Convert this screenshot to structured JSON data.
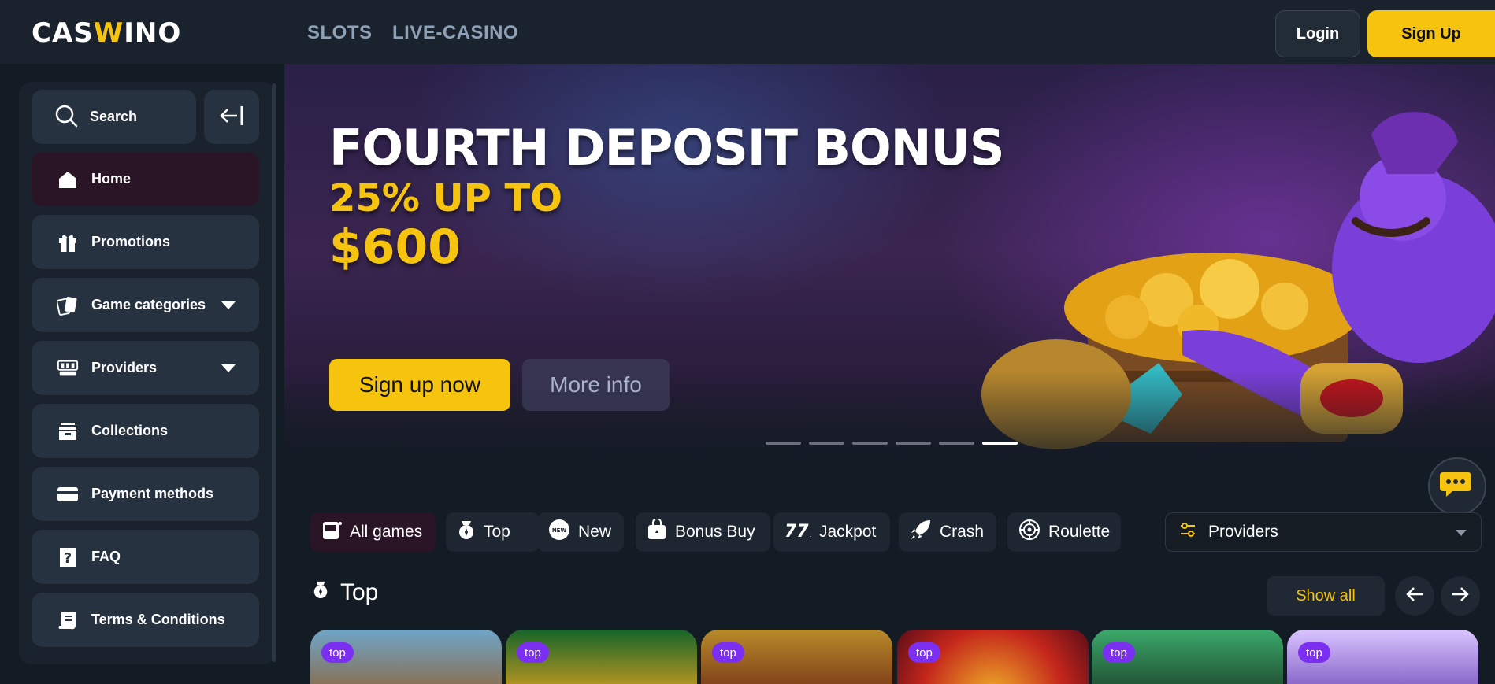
{
  "header": {
    "logo": "CASWINO",
    "nav": [
      "SLOTS",
      "LIVE-CASINO"
    ],
    "login_label": "Login",
    "signup_label": "Sign Up"
  },
  "sidebar": {
    "search_label": "Search",
    "items": [
      {
        "label": "Home",
        "icon": "home-icon",
        "active": true
      },
      {
        "label": "Promotions",
        "icon": "gift-icon"
      },
      {
        "label": "Game categories",
        "icon": "cards-icon",
        "expandable": true
      },
      {
        "label": "Providers",
        "icon": "providers-icon",
        "expandable": true
      },
      {
        "label": "Collections",
        "icon": "box-icon"
      },
      {
        "label": "Payment methods",
        "icon": "card-icon"
      },
      {
        "label": "FAQ",
        "icon": "question-icon"
      },
      {
        "label": "Terms & Conditions",
        "icon": "scroll-icon"
      }
    ]
  },
  "banner": {
    "title": "FOURTH DEPOSIT BONUS",
    "line1": "25% UP TO",
    "line2": "$600",
    "cta_primary": "Sign up now",
    "cta_secondary": "More info",
    "slide_count": 6,
    "active_slide": 6
  },
  "filters": {
    "chips": [
      "All games",
      "Top",
      "New",
      "Bonus Buy",
      "Jackpot",
      "Crash",
      "Roulette"
    ],
    "active": "All games",
    "providers_label": "Providers"
  },
  "section": {
    "title": "Top",
    "show_all": "Show all",
    "badge": "top"
  },
  "colors": {
    "accent": "#f6c30f",
    "background": "#131b24",
    "panel": "#263240",
    "badge": "#7b2ff0"
  }
}
